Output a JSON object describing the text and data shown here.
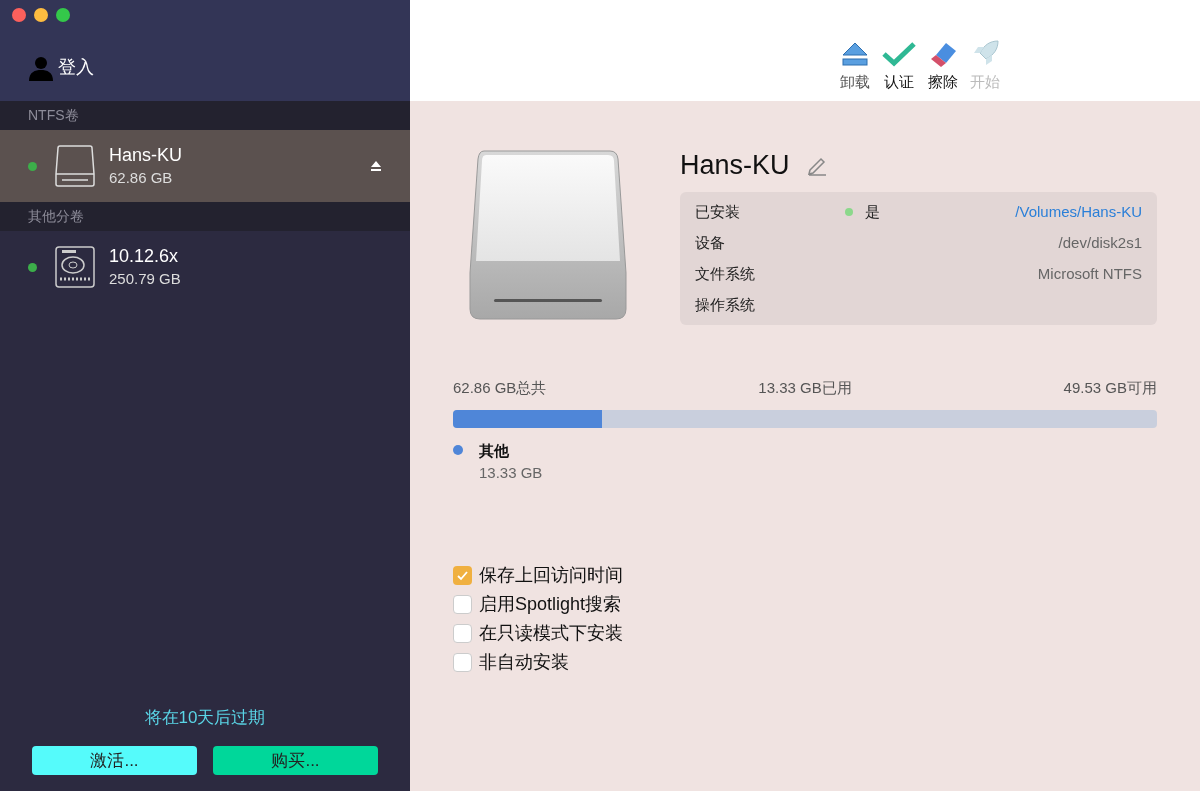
{
  "sidebar": {
    "login": "登入",
    "sections": [
      {
        "title": "NTFS卷",
        "volumes": [
          {
            "kind": "external",
            "name": "Hans-KU",
            "size": "62.86 GB",
            "selected": true,
            "mounted": true
          }
        ]
      },
      {
        "title": "其他分卷",
        "volumes": [
          {
            "kind": "internal",
            "name": "10.12.6x",
            "size": "250.79 GB",
            "selected": false,
            "mounted": true
          }
        ]
      }
    ],
    "expiry": "将在10天后过期",
    "buttons": [
      {
        "label": "激活...",
        "color": "#55fbfb"
      },
      {
        "label": "购买...",
        "color": "#00d79a"
      }
    ]
  },
  "toolbar": [
    {
      "kind": "unmount",
      "label": "卸载",
      "disabled": false
    },
    {
      "kind": "verify",
      "label": "认证",
      "disabled": false
    },
    {
      "kind": "erase",
      "label": "擦除",
      "disabled": false
    },
    {
      "kind": "start",
      "label": "开始",
      "disabled": true
    }
  ],
  "volume": {
    "name": "Hans-KU",
    "info": [
      {
        "label": "已安装",
        "status": "是",
        "value": "/Volumes/Hans-KU",
        "kind": "link"
      },
      {
        "label": "设备",
        "value": "/dev/disk2s1",
        "kind": "text"
      },
      {
        "label": "文件系统",
        "value": "Microsoft NTFS",
        "kind": "text"
      },
      {
        "label": "操作系统"
      }
    ],
    "usage": {
      "total": "62.86 GB总共",
      "used": "13.33 GB已用",
      "free": "49.53 GB可用",
      "level": 0.212
    },
    "legend": [
      {
        "name": "其他",
        "size": "13.33 GB",
        "color": "#4f86d8"
      }
    ],
    "options": [
      {
        "label": "保存上回访问时间",
        "checked": true
      },
      {
        "label": "启用Spotlight搜索",
        "checked": false
      },
      {
        "label": "在只读模式下安装",
        "checked": false
      },
      {
        "label": "非自动安装",
        "checked": false
      }
    ]
  }
}
